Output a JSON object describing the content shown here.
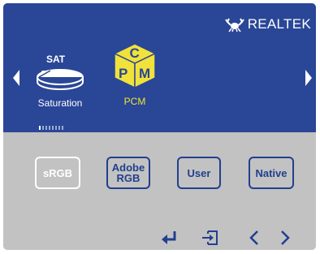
{
  "brand": {
    "name": "REALTEK",
    "logo_icon": "realtek-crab-logo-icon"
  },
  "nav": {
    "left_icon": "triangle-left-icon",
    "right_icon": "triangle-right-icon"
  },
  "menu_items": [
    {
      "label": "Saturation",
      "icon_text": "SAT",
      "icon": "saturation-dial-icon",
      "selected": false
    },
    {
      "label": "PCM",
      "icon_letters": [
        "C",
        "P",
        "M"
      ],
      "icon": "pcm-cube-icon",
      "selected": true
    }
  ],
  "page_indicator": {
    "total": 8,
    "active": 1
  },
  "options": [
    {
      "label": "sRGB",
      "selected": true
    },
    {
      "line1": "Adobe",
      "line2": "RGB",
      "selected": false
    },
    {
      "label": "User",
      "selected": false
    },
    {
      "label": "Native",
      "selected": false
    }
  ],
  "controls": [
    "enter-icon",
    "exit-icon",
    "chevron-left-icon",
    "chevron-right-icon"
  ],
  "colors": {
    "panel_blue": "#2a4696",
    "bottom_gray": "#c2c2c2",
    "option_blue": "#213f8e",
    "selected_white": "#ffffff",
    "pcm_yellow": "#f0e23a"
  }
}
